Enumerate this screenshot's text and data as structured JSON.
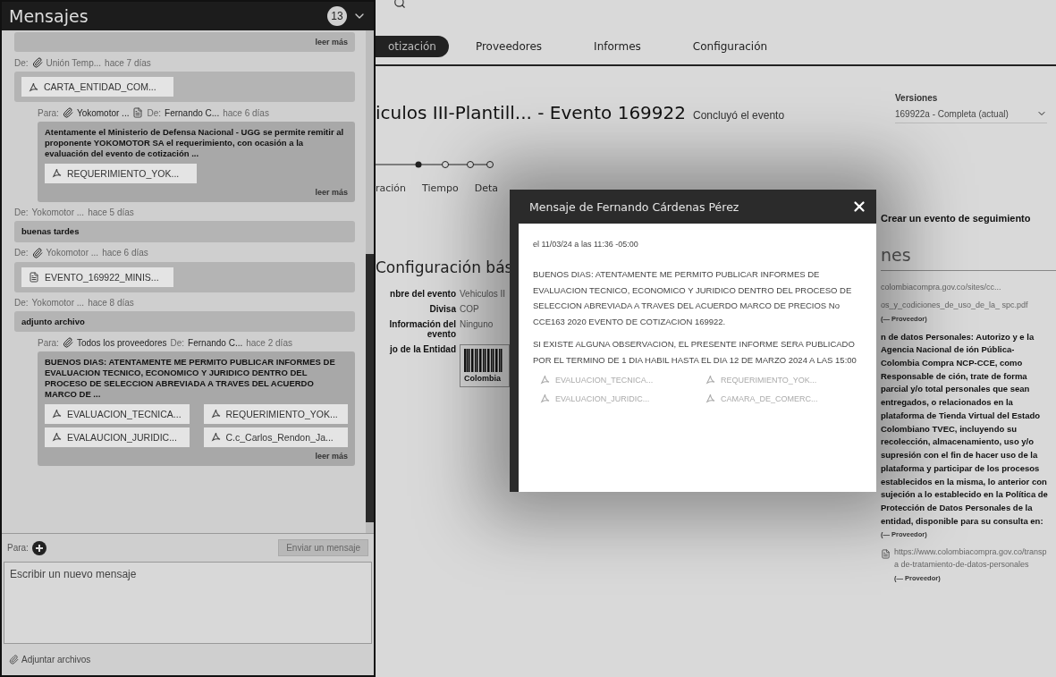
{
  "messages_panel": {
    "title": "Mensajes",
    "badge": "13",
    "messages": [
      {
        "kind": "incoming",
        "more": "leer más"
      },
      {
        "kind": "incoming",
        "participants": [
          {
            "kind": "clip",
            "label": "De:",
            "name": "Unión Temp..."
          }
        ],
        "time": "hace 7 días",
        "attachments": [
          {
            "kind": "pdf",
            "name": "CARTA_ENTIDAD_COM..."
          }
        ]
      },
      {
        "kind": "outgoing",
        "participants": [
          {
            "kind": "clip",
            "label": "Para:",
            "name": "Yokomotor ..."
          },
          {
            "kind": "doc",
            "label": "De:",
            "name": "Fernando C..."
          }
        ],
        "time": "hace 6 días",
        "text": "Atentamente el Ministerio de Defensa Nacional - UGG se permite remitir al proponente YOKOMOTOR SA el requerimiento, con ocasión a la evaluación del evento de cotización ...",
        "attachments": [
          {
            "kind": "pdf",
            "name": "REQUERIMIENTO_YOK..."
          }
        ],
        "more": "leer más"
      },
      {
        "kind": "incoming",
        "participants": [
          {
            "kind": "plain",
            "label": "De:",
            "name": "Yokomotor ..."
          }
        ],
        "time": "hace 5 días",
        "text": "buenas tardes"
      },
      {
        "kind": "incoming",
        "participants": [
          {
            "kind": "clip",
            "label": "De:",
            "name": "Yokomotor ..."
          }
        ],
        "time": "hace 6 días",
        "attachments": [
          {
            "kind": "doc",
            "name": "EVENTO_169922_MINIS..."
          }
        ]
      },
      {
        "kind": "incoming",
        "participants": [
          {
            "kind": "plain",
            "label": "De:",
            "name": "Yokomotor ..."
          }
        ],
        "time": "hace 8 días",
        "text": "adjunto archivo"
      },
      {
        "kind": "outgoing",
        "participants": [
          {
            "kind": "clip",
            "label": "Para:",
            "name": "Todos los proveedores"
          },
          {
            "kind": "plain",
            "label": "De:",
            "name": "Fernando C..."
          }
        ],
        "time": "hace 2 días",
        "text": "BUENOS DIAS: ATENTAMENTE ME PERMITO PUBLICAR INFORMES DE EVALUACION TECNICO, ECONOMICO Y JURIDICO DENTRO DEL PROCESO DE SELECCION ABREVIADA A TRAVES DEL ACUERDO MARCO DE ...",
        "attachments": [
          {
            "kind": "pdf",
            "name": "EVALUACION_TECNICA..."
          },
          {
            "kind": "pdf",
            "name": "REQUERIMIENTO_YOK..."
          },
          {
            "kind": "pdf",
            "name": "EVALAUCION_JURIDIC..."
          },
          {
            "kind": "pdf",
            "name": "C.c_Carlos_Rendon_Ja..."
          }
        ],
        "more": "leer más"
      }
    ],
    "composer": {
      "to_label": "Para:",
      "send_button": "Enviar un mensaje",
      "placeholder": "Escribir un nuevo mensaje",
      "attach_link": "Adjuntar archivos"
    }
  },
  "nav": {
    "tabs": [
      {
        "label": "otización",
        "selected": true
      },
      {
        "label": "Proveedores",
        "selected": false
      },
      {
        "label": "Informes",
        "selected": false
      },
      {
        "label": "Configuración",
        "selected": false
      }
    ]
  },
  "event": {
    "title": "iculos III-Plantill... - Evento 169922",
    "status": "Concluyó el evento",
    "versions_label": "Versiones",
    "version": "169922a - Completa (actual)"
  },
  "subtabs": [
    "ración",
    "Tiempo",
    "Deta"
  ],
  "section": {
    "heading": "Configuración bás",
    "fields": [
      {
        "kind": "text",
        "label": "nbre del evento",
        "value": "Vehiculos II"
      },
      {
        "kind": "text",
        "label": "Divisa",
        "value": "COP"
      },
      {
        "kind": "text",
        "label": "Información del evento",
        "value": "Ninguno"
      },
      {
        "kind": "logo",
        "label": "jo de la Entidad",
        "value": "Colombia"
      }
    ]
  },
  "sidebar": {
    "action": "Crear un evento de seguimiento",
    "heading": "nes",
    "items": [
      {
        "kind": "link",
        "text": "colombiacompra.gov.co/sites/cc..."
      },
      {
        "kind": "link",
        "text": "os_y_codiciones_de_uso_de_la_ spc.pdf",
        "note": "(— Proveedor)"
      },
      {
        "kind": "text",
        "text": "n de datos Personales: Autorizo y e la Agencia Nacional de ión Pública-Colombia Compra NCP-CCE, como Responsable de ción, trate de forma parcial y/o total personales que sean entregados, o relacionados en la plataforma de Tienda Virtual del Estado Colombiano TVEC, incluyendo su recolección, almacenamiento, uso y/o supresión con el fin de hacer uso de la plataforma y participar de los procesos establecidos en la misma, lo anterior con sujeción a lo establecido en la Política de Protección de Datos Personales de la entidad, disponible para su consulta en:",
        "note": "(— Proveedor)"
      },
      {
        "kind": "doc",
        "text": "https://www.colombiacompra.gov.co/transpa de-tratamiento-de-datos-personales",
        "note": "(— Proveedor)"
      }
    ]
  },
  "modal": {
    "title": "Mensaje de Fernando Cárdenas Pérez",
    "date": "el 11/03/24 a las 11:36 -05:00",
    "paragraphs": [
      "BUENOS DIAS: ATENTAMENTE ME PERMITO PUBLICAR INFORMES DE EVALUACION TECNICO, ECONOMICO Y JURIDICO DENTRO DEL PROCESO DE SELECCION ABREVIADA A TRAVES DEL ACUERDO MARCO DE PRECIOS No CCE163 2020 EVENTO DE COTIZACION 169922.",
      "SI EXISTE ALGUNA OBSERVACION, EL PRESENTE INFORME SERA PUBLICADO POR EL TERMINO DE 1 DIA HABIL HASTA EL DIA 12 DE MARZO 2024 A LAS 15:00"
    ],
    "attachments": [
      {
        "kind": "pdf",
        "name": "EVALUACION_TECNICA..."
      },
      {
        "kind": "pdf",
        "name": "REQUERIMIENTO_YOK..."
      },
      {
        "kind": "pdf",
        "name": "EVALUACION_JURIDIC..."
      },
      {
        "kind": "pdf",
        "name": "CAMARA_DE_COMERC..."
      }
    ]
  }
}
